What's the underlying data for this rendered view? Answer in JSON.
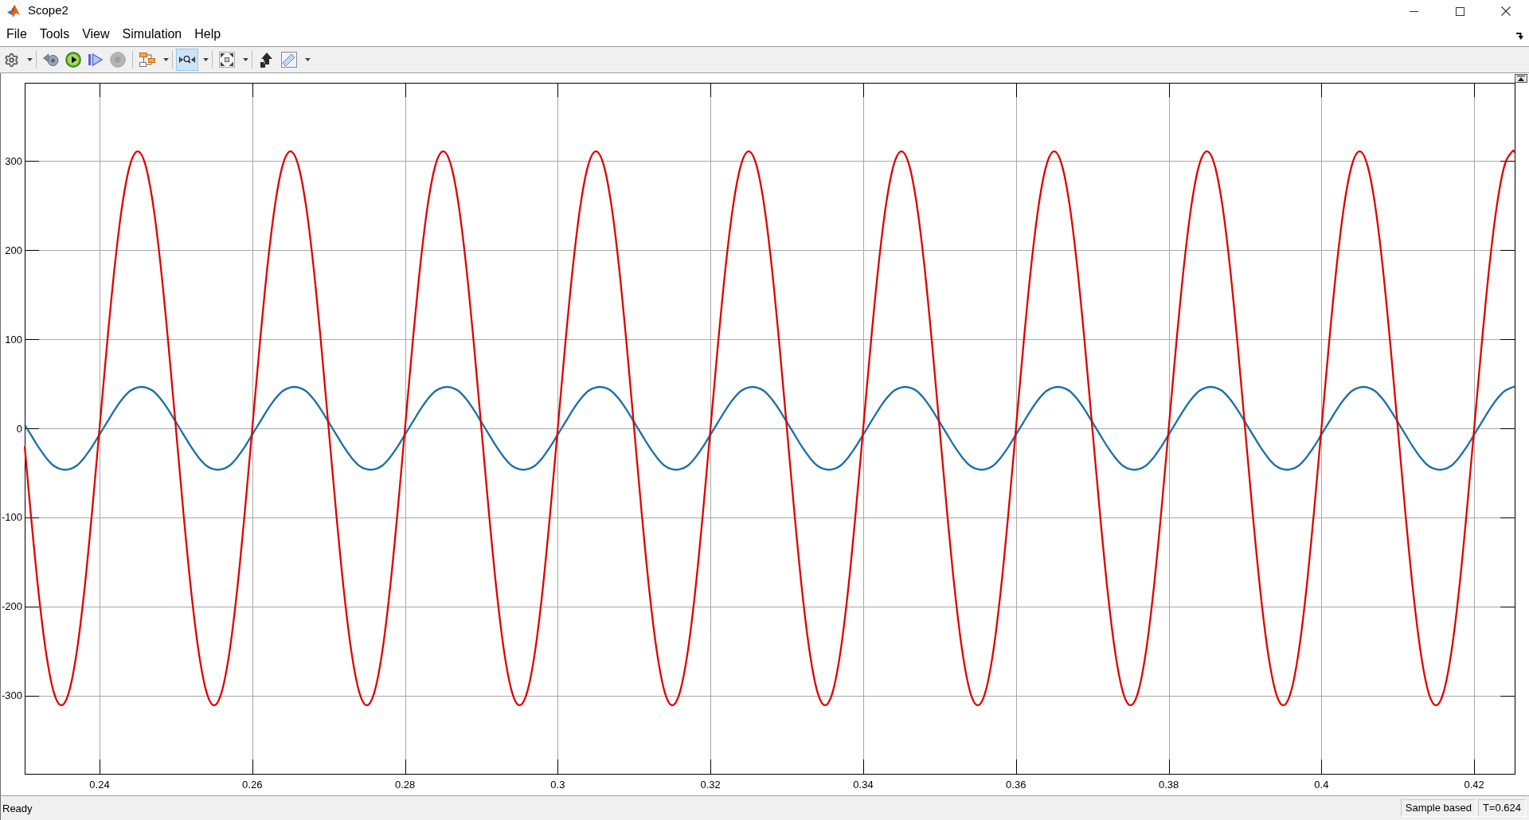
{
  "window": {
    "title": "Scope2"
  },
  "menu": [
    {
      "label": "File"
    },
    {
      "label": "Tools"
    },
    {
      "label": "View"
    },
    {
      "label": "Simulation"
    },
    {
      "label": "Help"
    }
  ],
  "toolbar": {
    "groups": [
      {
        "items": [
          {
            "selected": false,
            "disabled": false,
            "dropdown": true
          }
        ]
      },
      {
        "items": [
          {
            "selected": false,
            "disabled": false,
            "dropdown": false
          },
          {
            "selected": false,
            "disabled": false,
            "dropdown": false
          },
          {
            "selected": false,
            "disabled": false,
            "dropdown": false
          },
          {
            "selected": false,
            "disabled": true,
            "dropdown": false
          }
        ]
      },
      {
        "items": [
          {
            "selected": false,
            "disabled": false,
            "dropdown": true
          }
        ]
      },
      {
        "items": [
          {
            "selected": true,
            "disabled": false,
            "dropdown": true
          }
        ]
      },
      {
        "items": [
          {
            "selected": false,
            "disabled": false,
            "dropdown": true
          }
        ]
      },
      {
        "items": [
          {
            "selected": false,
            "disabled": false,
            "dropdown": false
          },
          {
            "selected": false,
            "disabled": false,
            "dropdown": true
          }
        ]
      }
    ]
  },
  "plot": {
    "chart_data": {
      "type": "line",
      "x": [
        0.2302,
        0.231,
        0.232,
        0.233,
        0.234,
        0.235,
        0.236,
        0.237,
        0.238,
        0.239,
        0.24,
        0.241,
        0.242,
        0.243,
        0.244,
        0.245,
        0.246,
        0.247,
        0.248,
        0.249,
        0.25,
        0.251,
        0.252,
        0.253,
        0.254,
        0.255,
        0.256,
        0.257,
        0.258,
        0.259,
        0.26,
        0.261,
        0.262,
        0.263,
        0.264,
        0.265,
        0.266,
        0.267,
        0.268,
        0.269,
        0.27,
        0.271,
        0.272,
        0.273,
        0.274,
        0.275,
        0.276,
        0.277,
        0.278,
        0.279,
        0.28,
        0.281,
        0.282,
        0.283,
        0.284,
        0.285,
        0.286,
        0.287,
        0.288,
        0.289,
        0.29,
        0.291,
        0.292,
        0.293,
        0.294,
        0.295,
        0.296,
        0.297,
        0.298,
        0.299,
        0.3,
        0.301,
        0.302,
        0.303,
        0.304,
        0.305,
        0.306,
        0.307,
        0.308,
        0.309,
        0.31,
        0.311,
        0.312,
        0.313,
        0.314,
        0.315,
        0.316,
        0.317,
        0.318,
        0.319,
        0.32,
        0.321,
        0.322,
        0.323,
        0.324,
        0.325,
        0.326,
        0.327,
        0.328,
        0.329,
        0.33,
        0.331,
        0.332,
        0.333,
        0.334,
        0.335,
        0.336,
        0.337,
        0.338,
        0.339,
        0.34,
        0.341,
        0.342,
        0.343,
        0.344,
        0.345,
        0.346,
        0.347,
        0.348,
        0.349,
        0.35,
        0.351,
        0.352,
        0.353,
        0.354,
        0.355,
        0.356,
        0.357,
        0.358,
        0.359,
        0.36,
        0.361,
        0.362,
        0.363,
        0.364,
        0.365,
        0.366,
        0.367,
        0.368,
        0.369,
        0.37,
        0.371,
        0.372,
        0.373,
        0.374,
        0.375,
        0.376,
        0.377,
        0.378,
        0.379,
        0.38,
        0.381,
        0.382,
        0.383,
        0.384,
        0.385,
        0.386,
        0.387,
        0.388,
        0.389,
        0.39,
        0.391,
        0.392,
        0.393,
        0.394,
        0.395,
        0.396,
        0.397,
        0.398,
        0.399,
        0.4,
        0.401,
        0.402,
        0.403,
        0.404,
        0.405,
        0.406,
        0.407,
        0.408,
        0.409,
        0.41,
        0.411,
        0.412,
        0.413,
        0.414,
        0.415,
        0.416,
        0.417,
        0.418,
        0.419,
        0.42,
        0.421,
        0.422,
        0.423,
        0.424,
        0.425,
        0.4253
      ],
      "series": [
        {
          "color": "#1a6fa5",
          "values": [
            4,
            -7,
            -21,
            -33,
            -42,
            -46,
            -46,
            -42,
            -33,
            -21,
            -7,
            7,
            21,
            33,
            42,
            46,
            46,
            42,
            33,
            21,
            7,
            -7,
            -21,
            -33,
            -42,
            -46,
            -46,
            -42,
            -33,
            -21,
            -7,
            7,
            21,
            33,
            42,
            46,
            46,
            42,
            33,
            21,
            7,
            -7,
            -21,
            -33,
            -42,
            -46,
            -46,
            -42,
            -33,
            -21,
            -7,
            7,
            21,
            33,
            42,
            46,
            46,
            42,
            33,
            21,
            7,
            -7,
            -21,
            -33,
            -42,
            -46,
            -46,
            -42,
            -33,
            -21,
            -7,
            7,
            21,
            33,
            42,
            46,
            46,
            42,
            33,
            21,
            7,
            -7,
            -21,
            -33,
            -42,
            -46,
            -46,
            -42,
            -33,
            -21,
            -7,
            7,
            21,
            33,
            42,
            46,
            46,
            42,
            33,
            21,
            7,
            -7,
            -21,
            -33,
            -42,
            -46,
            -46,
            -42,
            -33,
            -21,
            -7,
            7,
            21,
            33,
            42,
            46,
            46,
            42,
            33,
            21,
            7,
            -7,
            -21,
            -33,
            -42,
            -46,
            -46,
            -42,
            -33,
            -21,
            -7,
            7,
            21,
            33,
            42,
            46,
            46,
            42,
            33,
            21,
            7,
            -7,
            -21,
            -33,
            -42,
            -46,
            -46,
            -42,
            -33,
            -21,
            -7,
            7,
            21,
            33,
            42,
            46,
            46,
            42,
            33,
            21,
            7,
            -7,
            -21,
            -33,
            -42,
            -46,
            -46,
            -42,
            -33,
            -21,
            -7,
            7,
            21,
            33,
            42,
            46,
            46,
            42,
            33,
            21,
            7,
            -7,
            -21,
            -33,
            -42,
            -46,
            -46,
            -42,
            -33,
            -21,
            -7,
            7,
            21,
            33,
            42,
            46,
            47
          ]
        },
        {
          "color": "#e00000",
          "values": [
            -20,
            -96,
            -183,
            -252,
            -296,
            -311,
            -296,
            -252,
            -183,
            -96,
            0,
            96,
            183,
            252,
            296,
            311,
            296,
            252,
            183,
            96,
            0,
            -96,
            -183,
            -252,
            -296,
            -311,
            -296,
            -252,
            -183,
            -96,
            0,
            96,
            183,
            252,
            296,
            311,
            296,
            252,
            183,
            96,
            0,
            -96,
            -183,
            -252,
            -296,
            -311,
            -296,
            -252,
            -183,
            -96,
            0,
            96,
            183,
            252,
            296,
            311,
            296,
            252,
            183,
            96,
            0,
            -96,
            -183,
            -252,
            -296,
            -311,
            -296,
            -252,
            -183,
            -96,
            0,
            96,
            183,
            252,
            296,
            311,
            296,
            252,
            183,
            96,
            0,
            -96,
            -183,
            -252,
            -296,
            -311,
            -296,
            -252,
            -183,
            -96,
            0,
            96,
            183,
            252,
            296,
            311,
            296,
            252,
            183,
            96,
            0,
            -96,
            -183,
            -252,
            -296,
            -311,
            -296,
            -252,
            -183,
            -96,
            0,
            96,
            183,
            252,
            296,
            311,
            296,
            252,
            183,
            96,
            0,
            -96,
            -183,
            -252,
            -296,
            -311,
            -296,
            -252,
            -183,
            -96,
            0,
            96,
            183,
            252,
            296,
            311,
            296,
            252,
            183,
            96,
            0,
            -96,
            -183,
            -252,
            -296,
            -311,
            -296,
            -252,
            -183,
            -96,
            0,
            96,
            183,
            252,
            296,
            311,
            296,
            252,
            183,
            96,
            0,
            -96,
            -183,
            -252,
            -296,
            -311,
            -296,
            -252,
            -183,
            -96,
            0,
            96,
            183,
            252,
            296,
            311,
            296,
            252,
            183,
            96,
            0,
            -96,
            -183,
            -252,
            -296,
            -311,
            -296,
            -252,
            -183,
            -96,
            0,
            96,
            183,
            252,
            296,
            311,
            310
          ]
        }
      ],
      "xlim": [
        0.2302,
        0.4253
      ],
      "ylim": [
        -388,
        388
      ],
      "xticks": [
        0.24,
        0.26,
        0.28,
        0.3,
        0.32,
        0.34,
        0.36,
        0.38,
        0.4,
        0.42
      ],
      "yticks": [
        -300,
        -200,
        -100,
        0,
        100,
        200,
        300
      ],
      "grid": true
    }
  },
  "status_bar": {
    "text": "Ready",
    "fields": [
      "Sample based",
      "T=0.624"
    ]
  }
}
